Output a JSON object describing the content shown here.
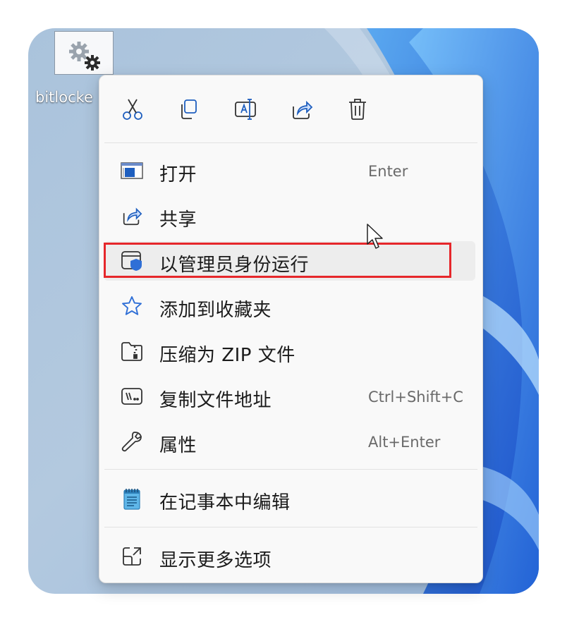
{
  "desktop": {
    "icon_label": "bitlocke",
    "icon": "gear-settings-icon"
  },
  "toolbar": [
    {
      "name": "cut-icon",
      "action": "cut"
    },
    {
      "name": "copy-icon",
      "action": "copy"
    },
    {
      "name": "rename-icon",
      "action": "rename"
    },
    {
      "name": "share-icon",
      "action": "share"
    },
    {
      "name": "delete-icon",
      "action": "delete"
    }
  ],
  "menu": {
    "items": [
      {
        "label": "打开",
        "shortcut": "Enter",
        "icon": "open-window-icon"
      },
      {
        "label": "共享",
        "shortcut": "",
        "icon": "share-icon"
      },
      {
        "label": "以管理员身份运行",
        "shortcut": "",
        "icon": "admin-shield-icon"
      },
      {
        "label": "添加到收藏夹",
        "shortcut": "",
        "icon": "star-icon"
      },
      {
        "label": "压缩为 ZIP 文件",
        "shortcut": "",
        "icon": "zip-folder-icon"
      },
      {
        "label": "复制文件地址",
        "shortcut": "Ctrl+Shift+C",
        "icon": "copy-path-icon"
      },
      {
        "label": "属性",
        "shortcut": "Alt+Enter",
        "icon": "wrench-icon"
      },
      {
        "label": "在记事本中编辑",
        "shortcut": "",
        "icon": "notepad-icon"
      },
      {
        "label": "显示更多选项",
        "shortcut": "",
        "icon": "show-more-icon"
      }
    ],
    "highlighted_item": "以管理员身份运行"
  },
  "colors": {
    "accent": "#2f6fd6",
    "highlight_border": "#e6272b",
    "menu_bg": "#f9f9f9"
  }
}
